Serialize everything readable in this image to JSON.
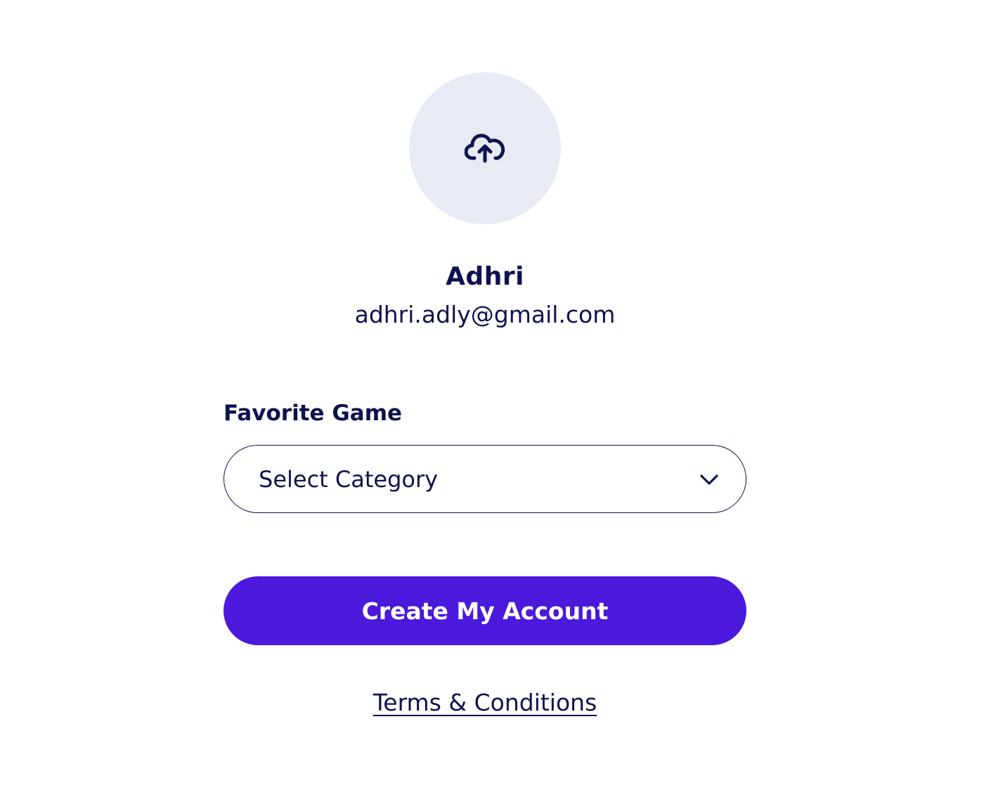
{
  "profile": {
    "avatar_upload_icon": "cloud-upload-icon",
    "name": "Adhri",
    "email": "adhri.adly@gmail.com"
  },
  "form": {
    "favorite_game_label": "Favorite Game",
    "category_select": {
      "value": "Select Category",
      "icon": "chevron-down-icon"
    },
    "submit_label": "Create My Account"
  },
  "footer": {
    "terms_label": "Terms & Conditions"
  },
  "colors": {
    "primary_text": "#10124f",
    "accent": "#4a19dc",
    "avatar_bg": "#e8eaf4",
    "background": "#ffffff"
  }
}
